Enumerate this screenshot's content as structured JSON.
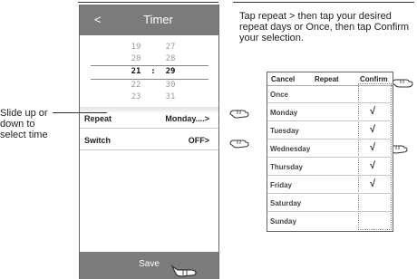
{
  "timer": {
    "title": "Timer",
    "back": "<",
    "picker": {
      "rows": [
        {
          "h": "19",
          "m": "27"
        },
        {
          "h": "20",
          "m": "28"
        },
        {
          "h": "21",
          "m": "29"
        },
        {
          "h": "22",
          "m": "30"
        },
        {
          "h": "23",
          "m": "31"
        }
      ],
      "separator": ":"
    },
    "repeat": {
      "label": "Repeat",
      "value": "Monday....>"
    },
    "switch": {
      "label": "Switch",
      "value": "OFF>"
    },
    "save": "Save"
  },
  "annotation_left": "Slide up or down to select time",
  "instructions": "Tap repeat > then tap your desired repeat days or Once, then tap Confirm your selection.",
  "days_panel": {
    "cancel": "Cancel",
    "title": "Repeat",
    "confirm": "Confirm",
    "items": [
      {
        "label": "Once",
        "check": ""
      },
      {
        "label": "Monday",
        "check": "√"
      },
      {
        "label": "Tuesday",
        "check": "√"
      },
      {
        "label": "Wednesday",
        "check": "√"
      },
      {
        "label": "Thursday",
        "check": "√"
      },
      {
        "label": "Friday",
        "check": "√"
      },
      {
        "label": "Saturday",
        "check": ""
      },
      {
        "label": "Sunday",
        "check": ""
      }
    ]
  }
}
